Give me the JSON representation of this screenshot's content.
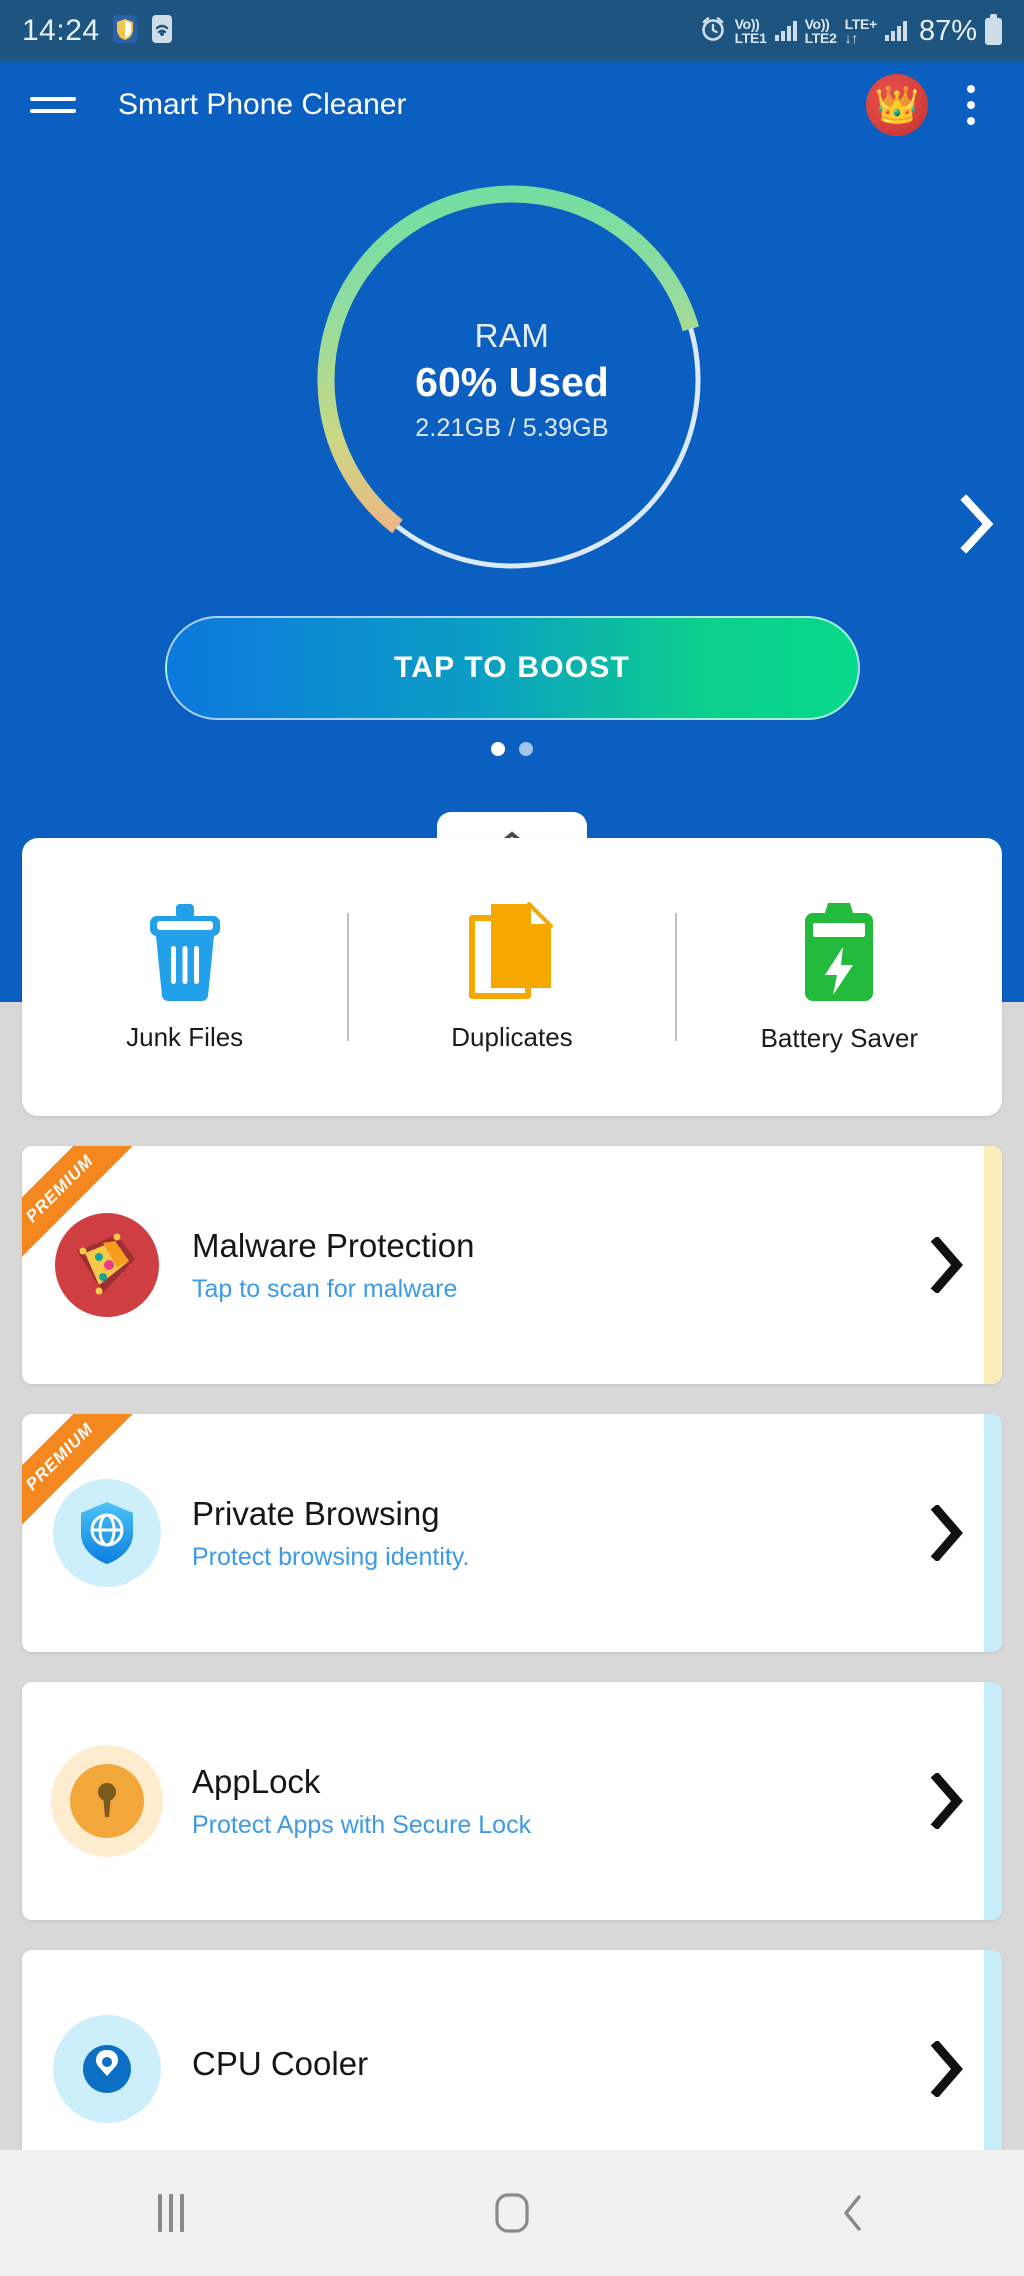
{
  "status_bar": {
    "time": "14:24",
    "icons_left": [
      "shield-icon",
      "wifi-icon"
    ],
    "alarm_icon": "alarm-icon",
    "sim1_line1": "Vo))",
    "sim1_line2": "LTE1",
    "sim2_line1": "Vo))",
    "sim2_line2": "LTE2",
    "lte_plus_line1": "LTE+",
    "lte_plus_line2": "↓↑",
    "battery_percent": "87%"
  },
  "app_bar": {
    "title": "Smart Phone Cleaner",
    "menu_icon": "hamburger-menu-icon",
    "premium_icon": "crown-icon",
    "premium_glyph": "👑",
    "overflow_icon": "overflow-menu-icon"
  },
  "gauge": {
    "label": "RAM",
    "percent_text": "60% Used",
    "detail": "2.21GB / 5.39GB",
    "percent_value": 60,
    "used_gb": "2.21GB",
    "total_gb": "5.39GB",
    "track_color": "#cfe4f7",
    "start_color": "#5de0a0",
    "mid_color": "#cbd884",
    "end_color": "#f0956a"
  },
  "hero": {
    "boost_label": "TAP TO BOOST",
    "next_icon": "chevron-right-icon",
    "page_dots": 2,
    "active_dot": 0,
    "collapse_icon": "chevron-up-icon"
  },
  "quick_tools": [
    {
      "label": "Junk Files",
      "icon": "trash-icon",
      "color": "#22a0ea"
    },
    {
      "label": "Duplicates",
      "icon": "copy-files-icon",
      "color": "#f5a800"
    },
    {
      "label": "Battery Saver",
      "icon": "battery-bolt-icon",
      "color": "#22bb3c"
    }
  ],
  "features": [
    {
      "title": "Malware Protection",
      "subtitle": "Tap to scan for malware",
      "premium": true,
      "badge_label": "PREMIUM",
      "icon": "malware-shield-icon",
      "icon_bg": "#cf3f42",
      "stripe_color": "#fbeeba",
      "chevron": "chevron-right-icon"
    },
    {
      "title": "Private Browsing",
      "subtitle": "Protect browsing identity.",
      "premium": true,
      "badge_label": "PREMIUM",
      "icon": "shield-globe-icon",
      "icon_bg": "#cdeefb",
      "stripe_color": "#c8edfa",
      "chevron": "chevron-right-icon"
    },
    {
      "title": "AppLock",
      "subtitle": "Protect Apps with Secure Lock",
      "premium": false,
      "badge_label": "",
      "icon": "padlock-keyhole-icon",
      "icon_bg": "#fdeccd",
      "stripe_color": "#c8edfa",
      "chevron": "chevron-right-icon"
    },
    {
      "title": "CPU Cooler",
      "subtitle": "",
      "premium": false,
      "badge_label": "",
      "icon": "cpu-cooler-icon",
      "icon_bg": "#cdeefb",
      "stripe_color": "#c8edfa",
      "chevron": "chevron-right-icon"
    }
  ],
  "nav_bar": {
    "recents_icon": "recents-icon",
    "home_icon": "home-icon",
    "back_icon": "back-icon"
  },
  "colors": {
    "brand_blue": "#0b5fc0",
    "status_bar": "#1d5480",
    "accent_orange": "#f5871f",
    "link_blue": "#3d9ae8",
    "page_bg": "#d8d8d8"
  }
}
